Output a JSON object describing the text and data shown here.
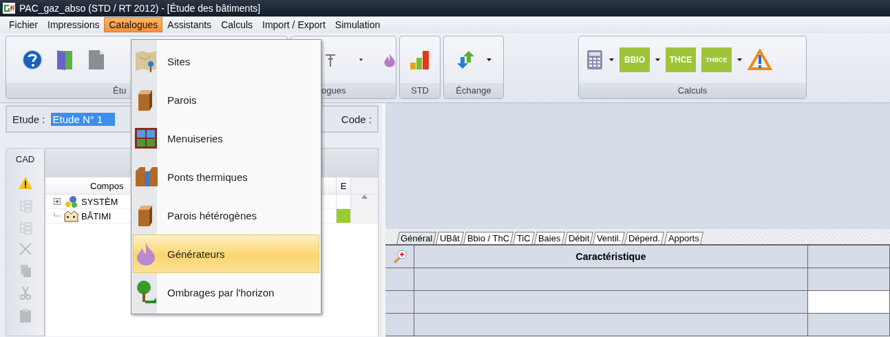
{
  "window": {
    "title": "PAC_gaz_abso (STD / RT 2012) - [Étude des bâtiments]"
  },
  "menu_bar": [
    {
      "label": "Fichier",
      "selected": false
    },
    {
      "label": "Impressions",
      "selected": false
    },
    {
      "label": "Catalogues",
      "selected": true
    },
    {
      "label": "Assistants",
      "selected": false
    },
    {
      "label": "Calculs",
      "selected": false
    },
    {
      "label": "Import / Export",
      "selected": false
    },
    {
      "label": "Simulation",
      "selected": false
    }
  ],
  "ribbon": {
    "groups": [
      {
        "kind": "etude",
        "label": "Étu",
        "buttons": [
          {
            "kind": "help",
            "dropdown": false
          },
          {
            "kind": "door",
            "dropdown": false
          },
          {
            "kind": "document",
            "dropdown": false
          }
        ]
      },
      {
        "kind": "catalogues",
        "label": "ogues",
        "buttons": [
          {
            "kind": "beam",
            "dropdown": true
          },
          {
            "kind": "flame",
            "dropdown": false
          }
        ]
      },
      {
        "kind": "std",
        "label": "STD",
        "buttons": [
          {
            "kind": "chart",
            "dropdown": false
          }
        ]
      },
      {
        "kind": "echange",
        "label": "Échange",
        "buttons": [
          {
            "kind": "arrows",
            "dropdown": true
          }
        ]
      },
      {
        "kind": "calculs",
        "label": "Calculs",
        "buttons": [
          {
            "kind": "calculator",
            "dropdown": true
          },
          {
            "kind": "tile",
            "text": "BBIO",
            "dropdown": true
          },
          {
            "kind": "tile",
            "text": "THCE",
            "dropdown": false
          },
          {
            "kind": "tile",
            "text": "THBCE",
            "dropdown": true
          },
          {
            "kind": "warning",
            "dropdown": false
          }
        ]
      }
    ]
  },
  "study": {
    "label": "Etude :",
    "value": "Etude N° 1",
    "code_label": "Code :"
  },
  "side_toolbar": {
    "tab": "CAD",
    "tools": [
      {
        "kind": "warning",
        "disabled": false
      },
      {
        "kind": "tree-add",
        "disabled": true
      },
      {
        "kind": "tree-remove",
        "disabled": true
      },
      {
        "kind": "delete",
        "disabled": true
      },
      {
        "kind": "copy",
        "disabled": true
      },
      {
        "kind": "cut",
        "disabled": true
      },
      {
        "kind": "paste",
        "disabled": true
      }
    ]
  },
  "tree": {
    "columns": [
      "Compos",
      "E"
    ],
    "rows": [
      {
        "kind": "systems",
        "label": "SYSTÈM",
        "expandable": true
      },
      {
        "kind": "building",
        "label": "BÂTIMI",
        "expandable": false,
        "color": "#9acd32"
      }
    ]
  },
  "tabs": [
    {
      "label": "Général",
      "selected": true
    },
    {
      "label": "UBât",
      "selected": false
    },
    {
      "label": "Bbio / ThC",
      "selected": false
    },
    {
      "label": "TiC",
      "selected": false
    },
    {
      "label": "Baies",
      "selected": false
    },
    {
      "label": "Débit",
      "selected": false
    },
    {
      "label": "Ventil.",
      "selected": false
    },
    {
      "label": "Déperd.",
      "selected": false
    },
    {
      "label": "Apports",
      "selected": false
    }
  ],
  "grid": {
    "header": "Caractéristique",
    "rows": [
      {
        "editable": false
      },
      {
        "editable": true
      },
      {
        "editable": false
      }
    ]
  },
  "catalogue_menu": {
    "items": [
      {
        "kind": "map",
        "label": "Sites",
        "selected": false
      },
      {
        "kind": "block",
        "label": "Parois",
        "selected": false
      },
      {
        "kind": "window",
        "label": "Menuiseries",
        "selected": false
      },
      {
        "kind": "bridge",
        "label": "Ponts thermiques",
        "selected": false
      },
      {
        "kind": "block",
        "label": "Parois hétérogènes",
        "selected": false
      },
      {
        "kind": "flame",
        "label": "Générateurs",
        "selected": true
      },
      {
        "kind": "tree",
        "label": "Ombrages par l'horizon",
        "selected": false
      }
    ]
  }
}
